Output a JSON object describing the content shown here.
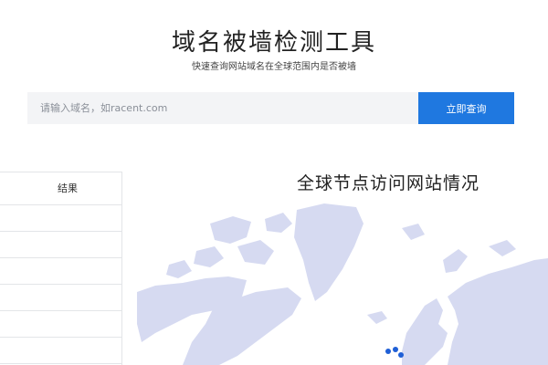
{
  "header": {
    "title": "域名被墙检测工具",
    "subtitle": "快速查询网站域名在全球范围内是否被墙"
  },
  "search": {
    "placeholder": "请输入域名，如racent.com",
    "value": "",
    "button_label": "立即查询"
  },
  "results": {
    "column_header": "结果",
    "rows": [
      "",
      "",
      "",
      "",
      "",
      ""
    ]
  },
  "map": {
    "title": "全球节点访问网站情况",
    "land_color": "#d6daf1",
    "node_color": "#1f5fd6"
  }
}
